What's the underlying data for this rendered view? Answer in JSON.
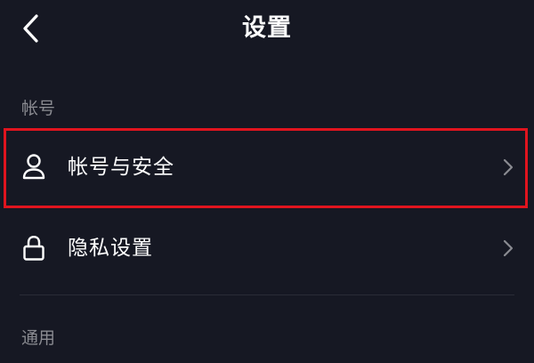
{
  "header": {
    "title": "设置",
    "back_icon": "chevron-left-icon"
  },
  "sections": {
    "account": {
      "label": "帐号",
      "items": [
        {
          "label": "帐号与安全",
          "icon": "user-icon",
          "highlighted": true,
          "highlight_color": "#e0141e"
        },
        {
          "label": "隐私设置",
          "icon": "lock-icon",
          "highlighted": false
        }
      ]
    },
    "general": {
      "label": "通用"
    }
  },
  "colors": {
    "background": "#161823",
    "text_primary": "#ffffff",
    "text_secondary": "#8a8b91",
    "chevron": "#8a8b91",
    "highlight": "#e0141e"
  }
}
